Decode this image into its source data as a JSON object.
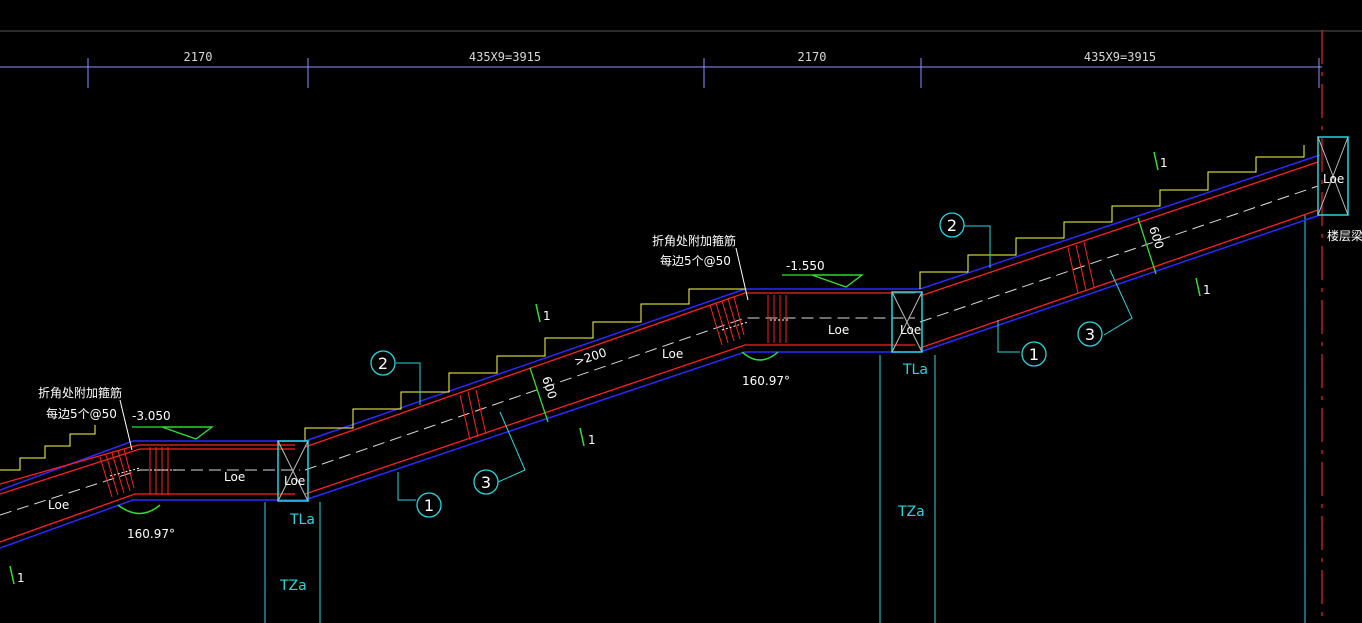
{
  "dimensions": [
    "2170",
    "435X9=3915",
    "2170",
    "435X9=3915"
  ],
  "elevations": [
    "-3.050",
    "-1.550"
  ],
  "notes": {
    "rebar_line1": "折角处附加箍筋",
    "rebar_line2": "每边5个@50",
    "floor_beam": "楼层梁"
  },
  "labels": {
    "loe": "Loe",
    "tla": "TLa",
    "tza": "TZa",
    "thickness": "600",
    "angle": "160.97°",
    "slope_mark": "1",
    "gap": ">200"
  },
  "bubbles": [
    "1",
    "2",
    "3"
  ],
  "colors": {
    "background": "#000000",
    "concrete": "#2a2aff",
    "rebar": "#ff2020",
    "step": "#ffff40",
    "leader": "#ffffff",
    "column": "#25d6e0",
    "slope": "#30e030",
    "dim_line": "#9090ff"
  }
}
